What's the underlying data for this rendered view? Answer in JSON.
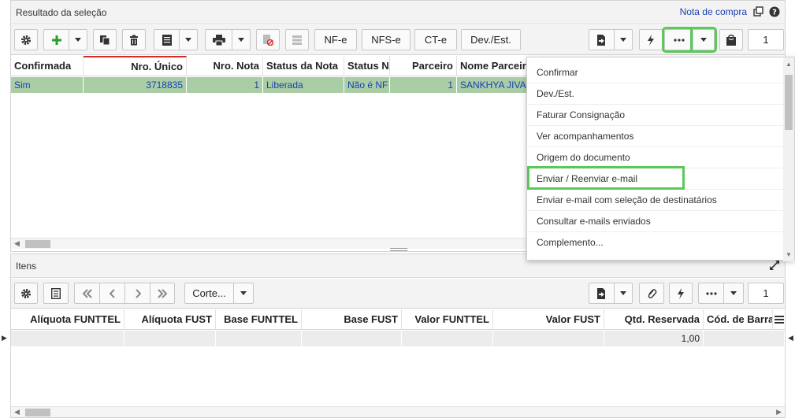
{
  "top_panel": {
    "title": "Resultado da seleção",
    "header_link": "Nota de compra",
    "toolbar": {
      "buttons": {
        "nfe": "NF-e",
        "nfse": "NFS-e",
        "cte": "CT-e",
        "dev_est": "Dev./Est."
      },
      "page": "1"
    },
    "columns": [
      "Confirmada",
      "Nro. Único",
      "Nro. Nota",
      "Status da Nota",
      "Status N",
      "Parceiro",
      "Nome Parceiro"
    ],
    "rows": [
      [
        "Sim",
        "3718835",
        "1",
        "Liberada",
        "Não é NF",
        "1",
        "SANKHYA JIVA"
      ]
    ]
  },
  "dropdown_menu": {
    "items": [
      "Confirmar",
      "Dev./Est.",
      "Faturar Consignação",
      "Ver acompanhamentos",
      "Origem do documento",
      "Enviar / Reenviar e-mail",
      "Enviar e-mail com seleção de destinatários",
      "Consultar e-mails enviados",
      "Complemento..."
    ],
    "highlighted_item": "Enviar / Reenviar e-mail"
  },
  "bottom_panel": {
    "title": "Itens",
    "toolbar": {
      "corte_label": "Corte...",
      "page": "1"
    },
    "columns": [
      "Alíquota FUNTTEL",
      "Alíquota FUST",
      "Base FUNTTEL",
      "Base FUST",
      "Valor FUNTTEL",
      "Valor FUST",
      "Qtd. Reservada",
      "Cód. de Barra"
    ],
    "rows": [
      [
        "",
        "",
        "",
        "",
        "",
        "",
        "1,00",
        ""
      ]
    ]
  },
  "colors": {
    "highlight": "#5cc85c",
    "selected_row": "#a9cda5",
    "link": "#1a3fb5"
  }
}
